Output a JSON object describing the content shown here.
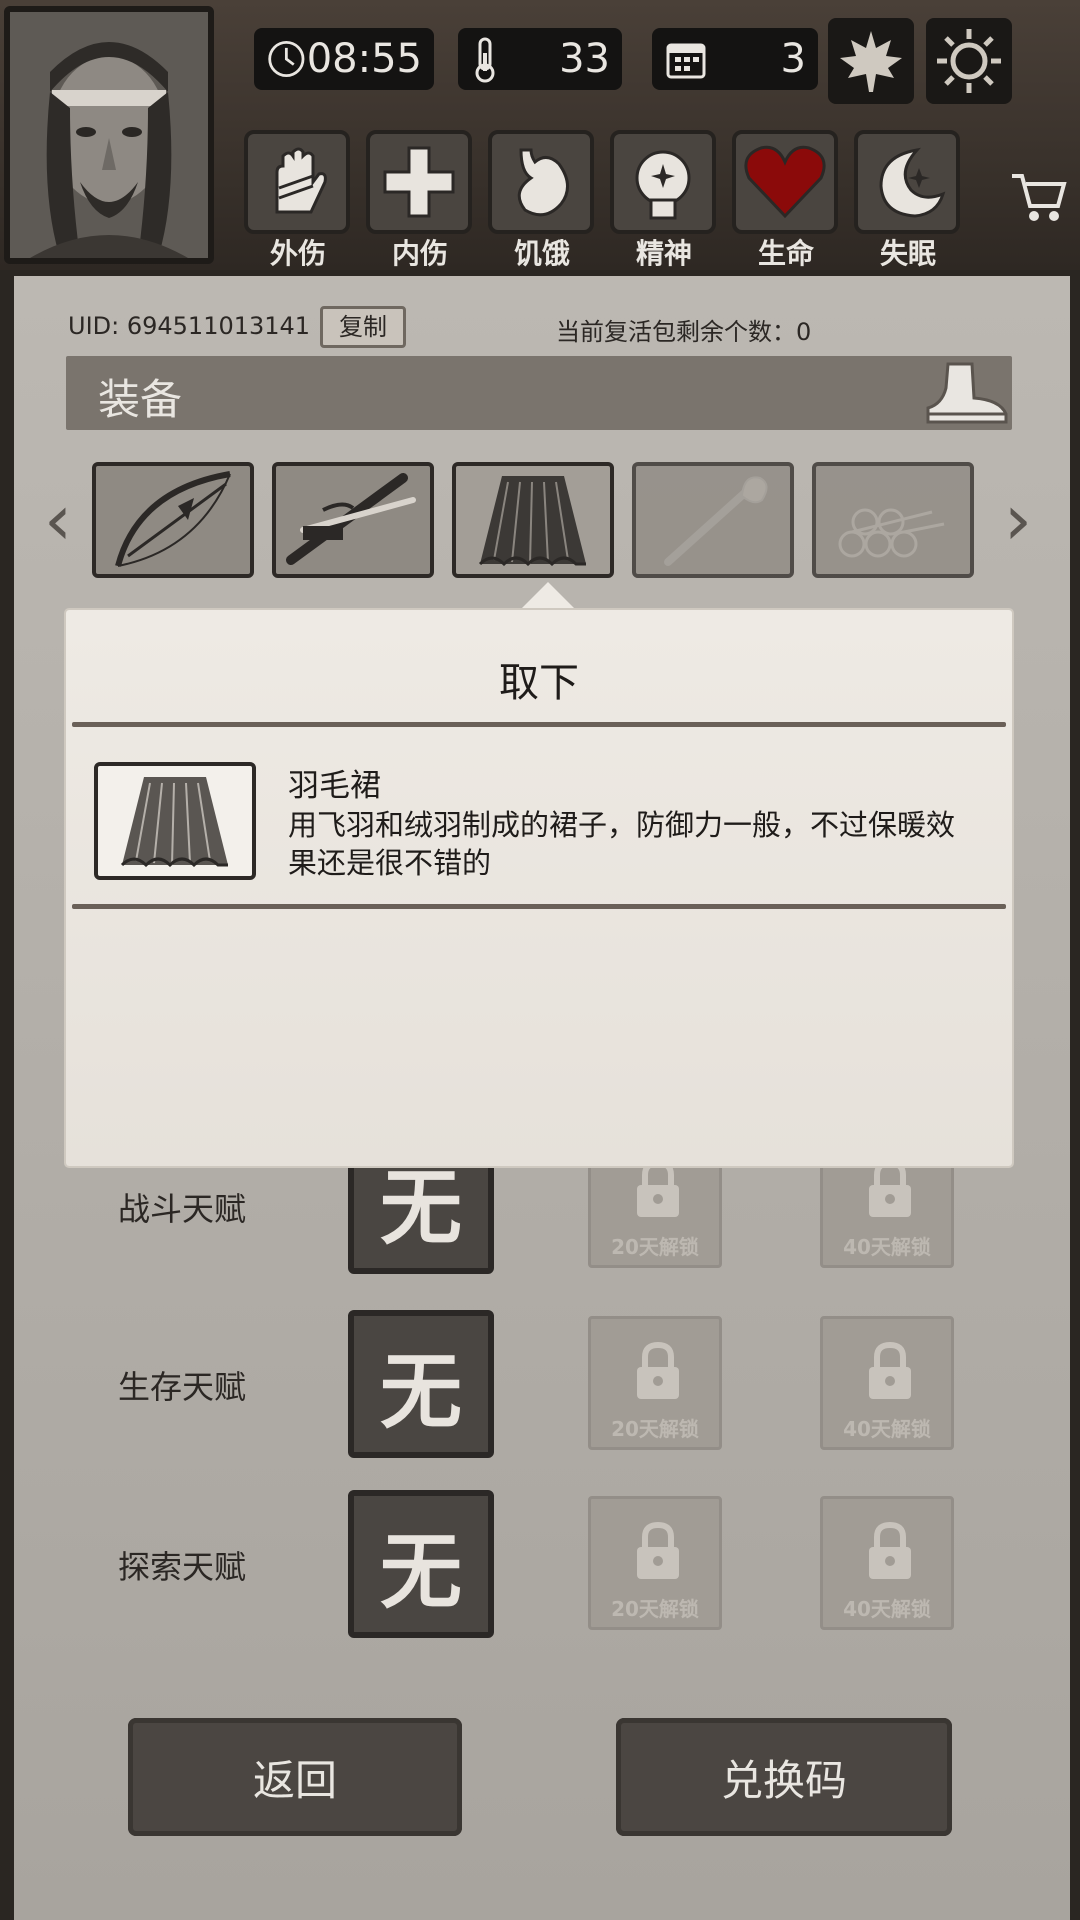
{
  "hud": {
    "time": "08:55",
    "temperature": "33",
    "day": "3"
  },
  "status_bars": [
    {
      "label": "外伤",
      "icon": "hand-bandage-icon"
    },
    {
      "label": "内伤",
      "icon": "cross-icon"
    },
    {
      "label": "饥饿",
      "icon": "stomach-icon"
    },
    {
      "label": "精神",
      "icon": "head-sparkle-icon"
    },
    {
      "label": "生命",
      "icon": "heart-icon"
    },
    {
      "label": "失眠",
      "icon": "moon-star-icon"
    }
  ],
  "account": {
    "uid": "UID: 694511013141",
    "copy_label": "复制",
    "revive_text": "当前复活包剩余个数：0"
  },
  "equipment": {
    "title": "装备",
    "slots": [
      {
        "icon": "bow-icon"
      },
      {
        "icon": "katana-icon"
      },
      {
        "icon": "feather-skirt-icon"
      },
      {
        "icon": "torch-icon"
      },
      {
        "icon": "log-bundle-icon"
      }
    ]
  },
  "popup": {
    "action": "取下",
    "item_name": "羽毛裙",
    "item_desc": "用飞羽和绒羽制成的裙子，防御力一般，不过保暖效果还是很不错的"
  },
  "talents": [
    {
      "label": "战斗天赋",
      "value": "无",
      "lock1": "20天解锁",
      "lock2": "40天解锁"
    },
    {
      "label": "生存天赋",
      "value": "无",
      "lock1": "20天解锁",
      "lock2": "40天解锁"
    },
    {
      "label": "探索天赋",
      "value": "无",
      "lock1": "20天解锁",
      "lock2": "40天解锁"
    }
  ],
  "buttons": {
    "back": "返回",
    "redeem": "兑换码"
  },
  "colors": {
    "heart": "#8b0a0a",
    "panel": "#b3afa9",
    "dark": "#4a4642"
  }
}
